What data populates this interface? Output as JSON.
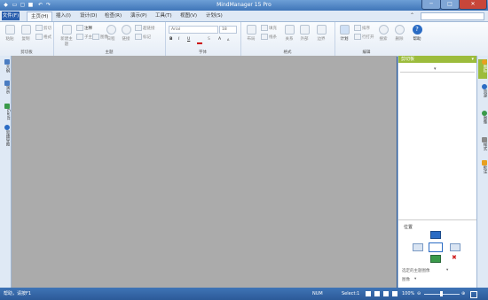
{
  "window": {
    "title": "MindManager 15 Pro"
  },
  "ribbon_tabs": {
    "file": "文件(F)",
    "tabs": [
      "主页(H)",
      "插入(I)",
      "设计(D)",
      "检查(R)",
      "演示(P)",
      "工具(T)",
      "视图(V)",
      "计划(S)"
    ],
    "help": "?"
  },
  "ribbon": {
    "clipboard": {
      "label": "剪切板",
      "paste": "粘贴",
      "copy": "复制",
      "cut": "剪切",
      "format": "格式"
    },
    "topics": {
      "label": "主题",
      "new_topic": "新建主题",
      "subtopic": "子主题",
      "callout": "注释",
      "image": "图像",
      "schedule": "日程",
      "link": "链接",
      "hyperlink": "超链接",
      "notes": "笔记",
      "tags": "标记"
    },
    "font": {
      "label": "字体",
      "font_name": "Arial",
      "font_size": "18",
      "bold": "B",
      "italic": "I",
      "underline": "U",
      "strike": "S",
      "grow": "A",
      "shrink": "A"
    },
    "format": {
      "label": "格式",
      "layout": "布局",
      "fill": "填充",
      "line": "线条",
      "relationship": "关系",
      "boundary": "外部",
      "style": "边界"
    },
    "edit": {
      "label": "编辑",
      "plan": "计划",
      "sort": "排序",
      "filter": "行打开",
      "find": "搜索",
      "delete": "删除",
      "help": "帮助"
    }
  },
  "left_tabs": [
    "大纲",
    "演示",
    "Gantt",
    "思维导图"
  ],
  "right_tabs": [
    "图标",
    "资源",
    "图像",
    "样式",
    "批注"
  ],
  "panel": {
    "title": "剪切板",
    "position_label": "位置",
    "placeholder": "选定的主题图像",
    "view_label": "图像"
  },
  "status": {
    "left": "帮助，请按F1",
    "num": "NUM",
    "select": "Select:1",
    "zoom": "100%"
  }
}
